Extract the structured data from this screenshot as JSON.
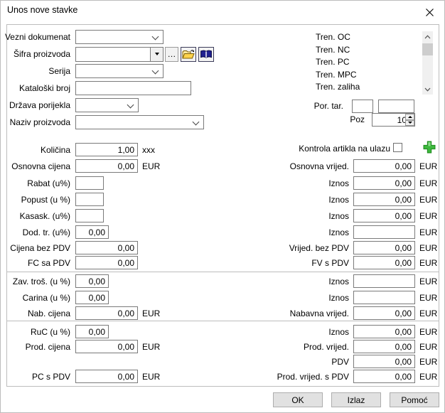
{
  "title": "Unos nove stavke",
  "fields": {
    "vezni": {
      "label": "Vezni dokumenat"
    },
    "sifra": {
      "label": "Šifra proizvoda",
      "more_button": "…"
    },
    "serija": {
      "label": "Serija"
    },
    "kataloski": {
      "label": "Kataloški broj",
      "value": ""
    },
    "drzava": {
      "label": "Država porijekla"
    },
    "naziv": {
      "label": "Naziv proizvoda"
    }
  },
  "tren_list": {
    "items": [
      "Tren. OC",
      "Tren. NC",
      "Tren. PC",
      "Tren. MPC",
      "Tren. zaliha"
    ]
  },
  "por_tar": {
    "label": "Por. tar.",
    "value1": "",
    "value2": ""
  },
  "poz": {
    "label": "Poz",
    "value": "10"
  },
  "kontrola": {
    "label": "Kontrola artikla na ulazu",
    "checked": false
  },
  "left_rows": [
    {
      "label": "Količina",
      "value": "1,00",
      "suffix": "xxx"
    },
    {
      "label": "Osnovna cijena",
      "value": "0,00",
      "suffix": "EUR"
    },
    {
      "label": "Rabat (u%)",
      "value": "",
      "suffix": ""
    },
    {
      "label": "Popust (u %)",
      "value": "",
      "suffix": ""
    },
    {
      "label": "Kasask. (u%)",
      "value": "",
      "suffix": ""
    },
    {
      "label": "Dod. tr. (u%)",
      "value": "0,00",
      "suffix": ""
    },
    {
      "label": "Cijena bez PDV",
      "value": "0,00",
      "suffix": ""
    },
    {
      "label": "FC sa PDV",
      "value": "0,00",
      "suffix": ""
    },
    {
      "label": "Zav. troš. (u %)",
      "value": "0,00",
      "suffix": ""
    },
    {
      "label": "Carina (u %)",
      "value": "0,00",
      "suffix": ""
    },
    {
      "label": "Nab. cijena",
      "value": "0,00",
      "suffix": "EUR"
    },
    {
      "label": "RuC (u %)",
      "value": "0,00",
      "suffix": ""
    },
    {
      "label": "Prod. cijena",
      "value": "0,00",
      "suffix": "EUR"
    },
    {
      "label": "PC s PDV",
      "value": "0,00",
      "suffix": "EUR"
    }
  ],
  "right_rows": [
    {
      "label": "Osnovna vrijed.",
      "value": "0,00",
      "suffix": "EUR"
    },
    {
      "label": "Iznos",
      "value": "0,00",
      "suffix": "EUR"
    },
    {
      "label": "Iznos",
      "value": "0,00",
      "suffix": "EUR"
    },
    {
      "label": "Iznos",
      "value": "0,00",
      "suffix": "EUR"
    },
    {
      "label": "Iznos",
      "value": "",
      "suffix": "EUR"
    },
    {
      "label": "Vrijed. bez PDV",
      "value": "0,00",
      "suffix": "EUR"
    },
    {
      "label": "FV s PDV",
      "value": "0,00",
      "suffix": "EUR"
    },
    {
      "label": "Iznos",
      "value": "",
      "suffix": "EUR"
    },
    {
      "label": "Iznos",
      "value": "",
      "suffix": "EUR"
    },
    {
      "label": "Nabavna vrijed.",
      "value": "0,00",
      "suffix": "EUR"
    },
    {
      "label": "Iznos",
      "value": "0,00",
      "suffix": "EUR"
    },
    {
      "label": "Prod. vrijed.",
      "value": "0,00",
      "suffix": "EUR"
    },
    {
      "label": "PDV",
      "value": "0,00",
      "suffix": "EUR"
    },
    {
      "label": "Prod. vrijed. s PDV",
      "value": "0,00",
      "suffix": "EUR"
    }
  ],
  "buttons": {
    "ok": "OK",
    "izlaz": "Izlaz",
    "pomoc": "Pomoć"
  },
  "colors": {
    "plus_green": "#3db83d",
    "book_navy": "#202090",
    "folder_yellow": "#ffd34d"
  }
}
